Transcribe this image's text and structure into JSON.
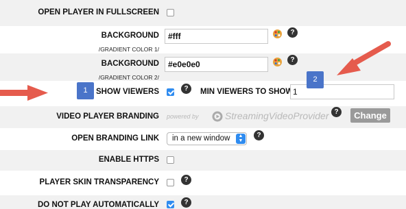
{
  "rows": {
    "fullscreen": {
      "label": "OPEN PLAYER IN FULLSCREEN"
    },
    "background1": {
      "label": "BACKGROUND",
      "sublabel": "/GRADIENT COLOR 1/",
      "value": "#fff"
    },
    "background2": {
      "label": "BACKGROUND",
      "sublabel": "/GRADIENT COLOR 2/",
      "value": "#e0e0e0"
    },
    "show_viewers": {
      "label": "SHOW VIEWERS",
      "checked": true
    },
    "min_viewers": {
      "label": "MIN VIEWERS TO SHOW",
      "value": "1"
    },
    "branding": {
      "label": "VIDEO PLAYER BRANDING",
      "powered_by": "powered by",
      "brand_name": "StreamingVideoProvider",
      "change_label": "Change"
    },
    "branding_link": {
      "label": "OPEN BRANDING LINK",
      "selected": "in a new window"
    },
    "https": {
      "label": "ENABLE HTTPS"
    },
    "skin_transparency": {
      "label": "PLAYER SKIN TRANSPARENCY"
    },
    "autoplay": {
      "label": "DO NOT PLAY AUTOMATICALLY",
      "checked": true
    }
  },
  "help_glyph": "?",
  "annotations": {
    "badge1": "1",
    "badge2": "2"
  },
  "colors": {
    "accent": "#2f8cf0",
    "arrow": "#e55b4d",
    "badge": "#4a74c9"
  }
}
